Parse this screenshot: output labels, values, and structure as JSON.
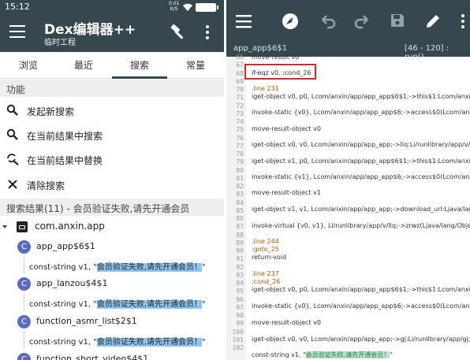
{
  "status": {
    "time": "15:12",
    "net_top": "0.01",
    "net_bottom": "K/S"
  },
  "app": {
    "title": "Dex编辑器++",
    "subtitle": "临时工程"
  },
  "tabs": [
    "浏览",
    "最近",
    "搜索",
    "常量"
  ],
  "functions": {
    "header": "功能",
    "items": [
      "发起新搜索",
      "在当前结果中搜索",
      "在当前结果中替换",
      "清除搜索"
    ]
  },
  "results": {
    "header": "搜索结果(11) - 会员验证失败,请先开通会员",
    "package": "com.anxin.app",
    "classes": [
      "app_app$6$1",
      "app_lanzou$4$1",
      "function_asmr_list$2$1",
      "function_short_video$4$1"
    ],
    "string_prefix": "const-string v1, \"",
    "string_value": "会员验证失败,请先开通会员！",
    "string_suffix": "\""
  },
  "editor": {
    "file_tab": "app_app$6$1",
    "range": "[46 - 120] : run()",
    "line_numbers": [
      "66",
      "67",
      "68",
      "69",
      "70",
      "71",
      "72",
      "73",
      "74",
      "75",
      "76",
      "77",
      "78",
      "79",
      "80",
      "81",
      "82",
      "83",
      "84",
      "85",
      "86",
      "87",
      "88",
      "89",
      "90",
      "91",
      "92",
      "93",
      "94",
      "95",
      "96",
      "97",
      "98",
      "99",
      "100",
      "101",
      "102"
    ],
    "lines": {
      "l66": "move-result v0",
      "l67_op": "if-eqz",
      "l67_rest": " v0, :cond_26",
      "l69": ".line 231",
      "l70": "iget-object v0, p0, Lcom/anxin/app/app_app$6$1;->this$1:Lcom/anxin/a",
      "l72": "invoke-static {v0}, Lcom/anxin/app/app_app$6;->access$0(Lcom/anxin/a",
      "l74": "move-result-object v0",
      "l76": "iget-object v0, v0, Lcom/anxin/app/app_app;->llq:Li/runlibrary/app/v/llq;",
      "l78": "iget-object v1, p0, Lcom/anxin/app/app_app$6$1;->this$1:Lcom/anxin/a",
      "l80": "invoke-static {v1}, Lcom/anxin/app/app_app$6;->access$0(Lcom/anxin/a",
      "l82": "move-result-object v1",
      "l84": "iget-object v1, v1, Lcom/anxin/app/app_app;->download_url:Ljava/lang/",
      "l86": "invoke-virtual {v0, v1}, Li/runlibrary/app/v/llq;->zrwz(Ljava/lang/Object;)V",
      "l88": ".line 244",
      "l89": ":goto_25",
      "l90": "return-void",
      "l92": ".line 237",
      "l93": ":cond_26",
      "l94": "iget-object v0, p0, Lcom/anxin/app/app_app$6$1;->this$1:Lcom/anxin/a",
      "l96": "invoke-static {v0}, Lcom/anxin/app/app_app$6;->access$0(Lcom/anxin/a",
      "l98": "move-result-object v0",
      "l100": "iget-object v0, v0, Lcom/anxin/app/app_app;->gj:Li/runlibrary/app/gj;",
      "l102_a": "const-string v1, \"",
      "l102_b": "会员验证失败,请先开通会员！",
      "l102_c": "\""
    }
  },
  "colors": {
    "toolbar": "#37474f",
    "highlight": "#8ec5ef",
    "box": "#d9262d"
  }
}
